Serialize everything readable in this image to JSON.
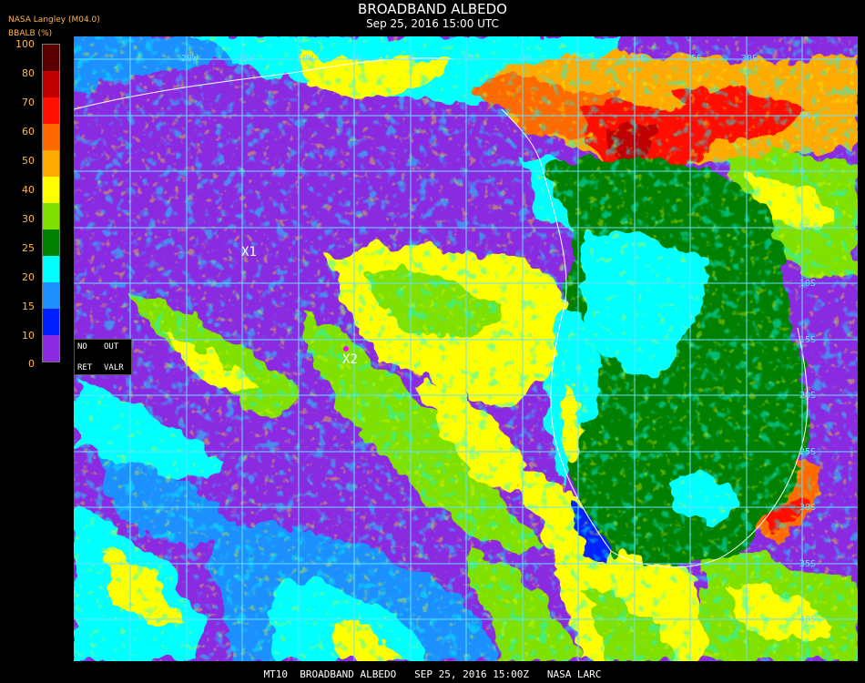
{
  "header": {
    "title": "BROADBAND ALBEDO",
    "subtitle": "Sep 25, 2016 15:00 UTC",
    "source": "NASA Langley (M04.0)"
  },
  "legend": {
    "title": "BBALB (%)",
    "ticks": [
      "100",
      "80",
      "70",
      "60",
      "50",
      "40",
      "30",
      "25",
      "20",
      "15",
      "10",
      "0"
    ],
    "colors": [
      "#5a0000",
      "#c00000",
      "#ff1000",
      "#ff6a00",
      "#ffaa00",
      "#ffff00",
      "#80e000",
      "#008000",
      "#00ffff",
      "#1e90ff",
      "#0020ff",
      "#8a2be2"
    ]
  },
  "map": {
    "markers": [
      {
        "label": "X1"
      },
      {
        "label": "X2"
      }
    ],
    "grid_lon_labels": [
      "20W",
      "15W",
      "10W",
      "5W",
      "0",
      "5E",
      "10E",
      "15E",
      "20E",
      "25E",
      "30E"
    ],
    "grid_lat_labels": [
      "5N",
      "0",
      "5S",
      "10S",
      "15S",
      "20S",
      "25S",
      "30S",
      "35S",
      "40S"
    ]
  },
  "info_box": {
    "no": "NO",
    "out": "OUT",
    "ret": "RET",
    "valr": "VALR"
  },
  "footer": {
    "caption": "MT10  BROADBAND ALBEDO   SEP 25, 2016 15:00Z   NASA LARC"
  }
}
